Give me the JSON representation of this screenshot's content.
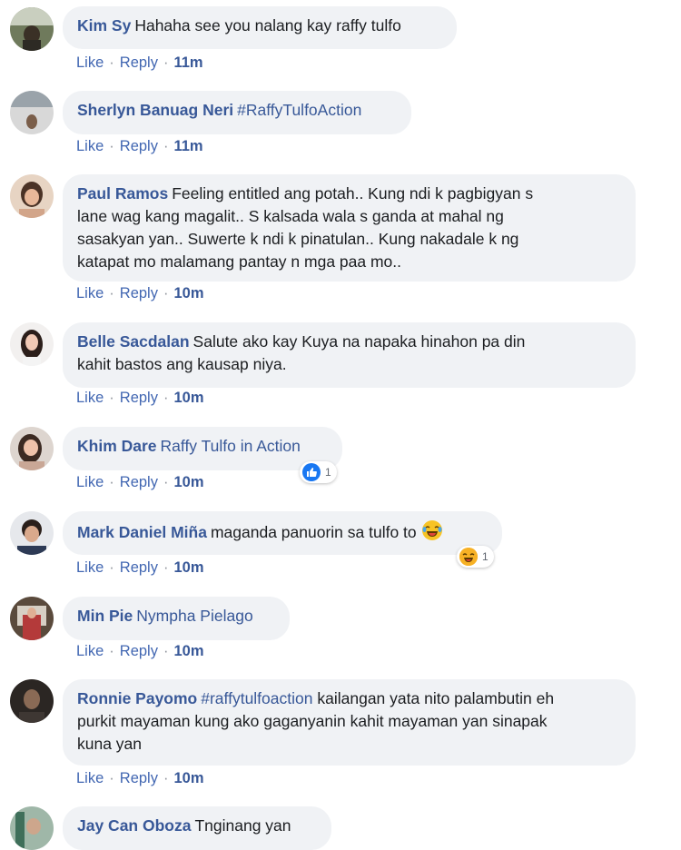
{
  "actions": {
    "like": "Like",
    "reply": "Reply",
    "sep": "·"
  },
  "comments": [
    {
      "name": "Kim Sy",
      "text": "Hahaha see you nalang kay raffy tulfo",
      "time": "11m",
      "reply": true
    },
    {
      "name": "Sherlyn Banuag Neri",
      "tag": "#RaffyTulfoAction",
      "time": "11m",
      "reply": true
    },
    {
      "name": "Paul Ramos",
      "lines": [
        "Feeling entitled ang potah.. Kung ndi k pagbigyan s",
        "lane wag kang magalit.. S kalsada wala s ganda at mahal ng",
        "sasakyan yan.. Suwerte k ndi k pinatulan.. Kung nakadale k ng",
        "katapat mo malamang pantay n mga paa mo.."
      ],
      "time": "10m",
      "reply": true
    },
    {
      "name": "Belle Sacdalan",
      "lines": [
        "Salute ako kay Kuya na napaka hinahon pa din",
        "kahit bastos ang kausap niya."
      ],
      "time": "10m",
      "reply": true
    },
    {
      "name": "Khim Dare",
      "tag": "Raffy Tulfo in Action",
      "time": "10m",
      "reply": true,
      "reaction": {
        "type": "like-icon",
        "count": "1"
      }
    },
    {
      "name": "Mark Daniel Miña",
      "text": "maganda panuorin sa tulfo to",
      "emoji": "laughing-crying-emoji",
      "time": "10m",
      "reply": true,
      "reaction": {
        "type": "haha-icon",
        "count": "1"
      }
    },
    {
      "name": "Min Pie",
      "tag": "Nympha Pielago",
      "time": "10m",
      "reply": true
    },
    {
      "name": "Ronnie Payomo",
      "tag": "#raffytulfoaction",
      "lines": [
        "kailangan yata nito palambutin eh",
        "purkit mayaman kung ako gaganyanin kahit mayaman yan sinapak",
        "kuna yan"
      ],
      "time": "10m",
      "reply": true
    },
    {
      "name": "Jay Can Oboza",
      "text": "Tnginang yan"
    }
  ],
  "colors": {
    "name": "#385898",
    "bubble": "#f0f2f5",
    "link": "#4267b2",
    "like_blue": "#1877f2",
    "haha_yellow": "#f7b125"
  }
}
